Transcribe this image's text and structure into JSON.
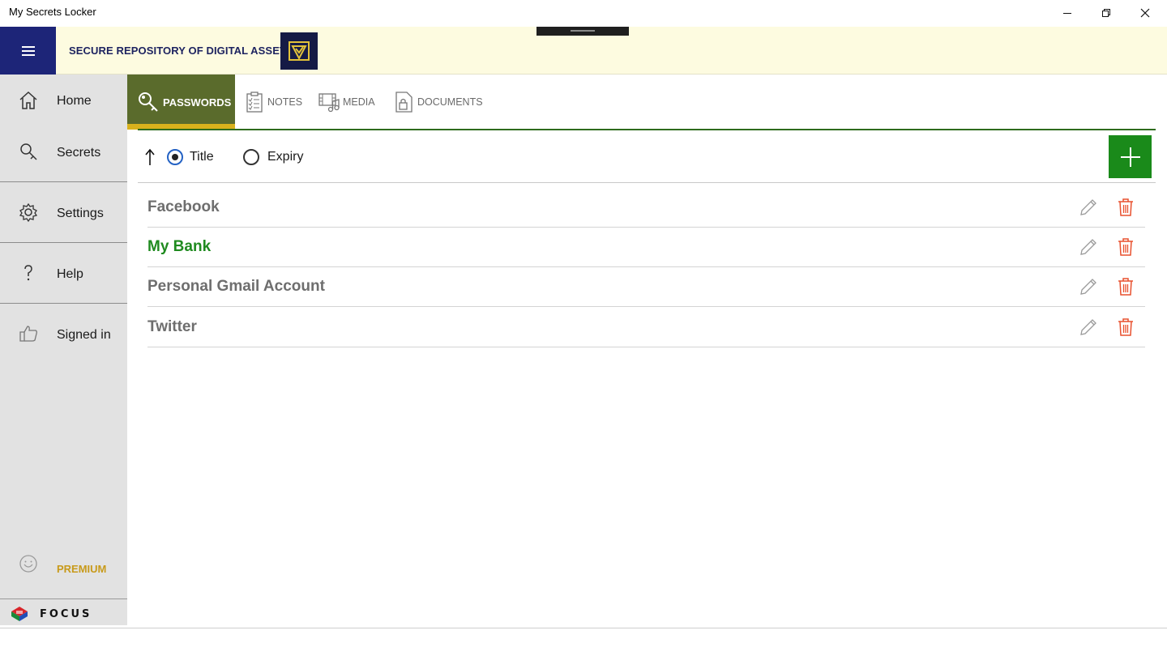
{
  "window": {
    "title": "My Secrets Locker"
  },
  "header": {
    "tagline": "SECURE REPOSITORY OF DIGITAL ASSETS",
    "menu_icon": "hamburger-icon",
    "logo_icon": "shield-check-logo"
  },
  "sidebar": {
    "items": [
      {
        "label": "Home",
        "icon": "home-icon"
      },
      {
        "label": "Secrets",
        "icon": "key-icon"
      },
      {
        "label": "Settings",
        "icon": "gear-icon"
      },
      {
        "label": "Help",
        "icon": "question-icon"
      },
      {
        "label": "Signed in",
        "icon": "thumbs-up-icon"
      }
    ],
    "premium": {
      "label": "PREMIUM",
      "icon": "smiley-icon"
    },
    "brand": {
      "label": "FOCUS"
    }
  },
  "tabs": [
    {
      "label": "PASSWORDS",
      "icon": "key-icon",
      "active": true
    },
    {
      "label": "NOTES",
      "icon": "checklist-icon",
      "active": false
    },
    {
      "label": "MEDIA",
      "icon": "film-music-icon",
      "active": false
    },
    {
      "label": "DOCUMENTS",
      "icon": "document-lock-icon",
      "active": false
    }
  ],
  "sort": {
    "direction_icon": "arrow-up-icon",
    "options": [
      {
        "label": "Title",
        "checked": true
      },
      {
        "label": "Expiry",
        "checked": false
      }
    ]
  },
  "add_button": {
    "icon": "plus-icon"
  },
  "entries": [
    {
      "title": "Facebook",
      "selected": false
    },
    {
      "title": "My Bank",
      "selected": true
    },
    {
      "title": "Personal Gmail Account",
      "selected": false
    },
    {
      "title": "Twitter",
      "selected": false
    }
  ],
  "colors": {
    "nav_blue": "#1d2578",
    "header_bg": "#fdfbe0",
    "active_tab": "#5a6b2c",
    "tab_accent": "#d8b11c",
    "add_green": "#1a8a1a",
    "selected_text": "#1f8a1f",
    "delete_red": "#e8502e",
    "premium_gold": "#c89a1a"
  }
}
